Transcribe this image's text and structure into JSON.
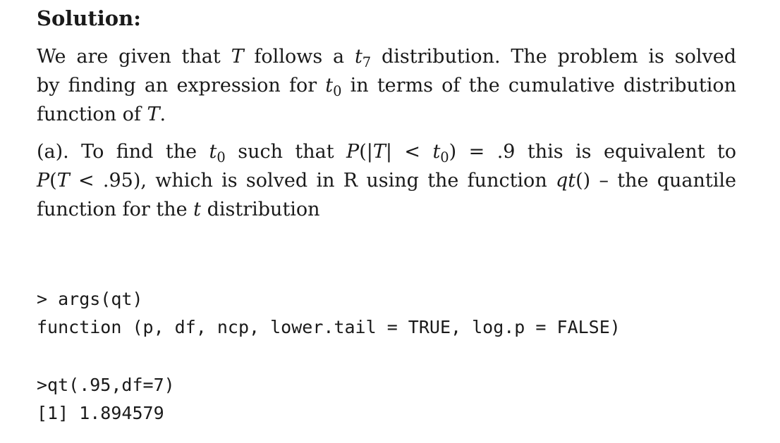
{
  "heading": "Solution:",
  "para1": {
    "l1_a": "We are given that ",
    "T": "T",
    "l1_b": " follows a ",
    "t": "t",
    "sub7": "7",
    "l1_c": " distribution. The problem is solved",
    "l2_a": "by finding an expression for ",
    "sub0": "0",
    "l2_b": " in terms of the cumulative distribution",
    "l3_a": "function of ",
    "l3_b": "."
  },
  "para2": {
    "l1_a": "(a). To find the ",
    "l1_b": " such that ",
    "P": "P",
    "l1_c": "(|",
    "l1_d": "| < ",
    "l1_e": ") = .9 this is equivalent to",
    "l2_a": "(",
    "l2_b": " < .95), which is solved in R using the function ",
    "qt": "qt",
    "l2_c": "() – the quantile",
    "l3_a": "function for the ",
    "l3_b": " distribution"
  },
  "code": [
    "> args(qt)",
    "function (p, df, ncp, lower.tail = TRUE, log.p = FALSE)",
    ">qt(.95,df=7)",
    "[1] 1.894579"
  ]
}
